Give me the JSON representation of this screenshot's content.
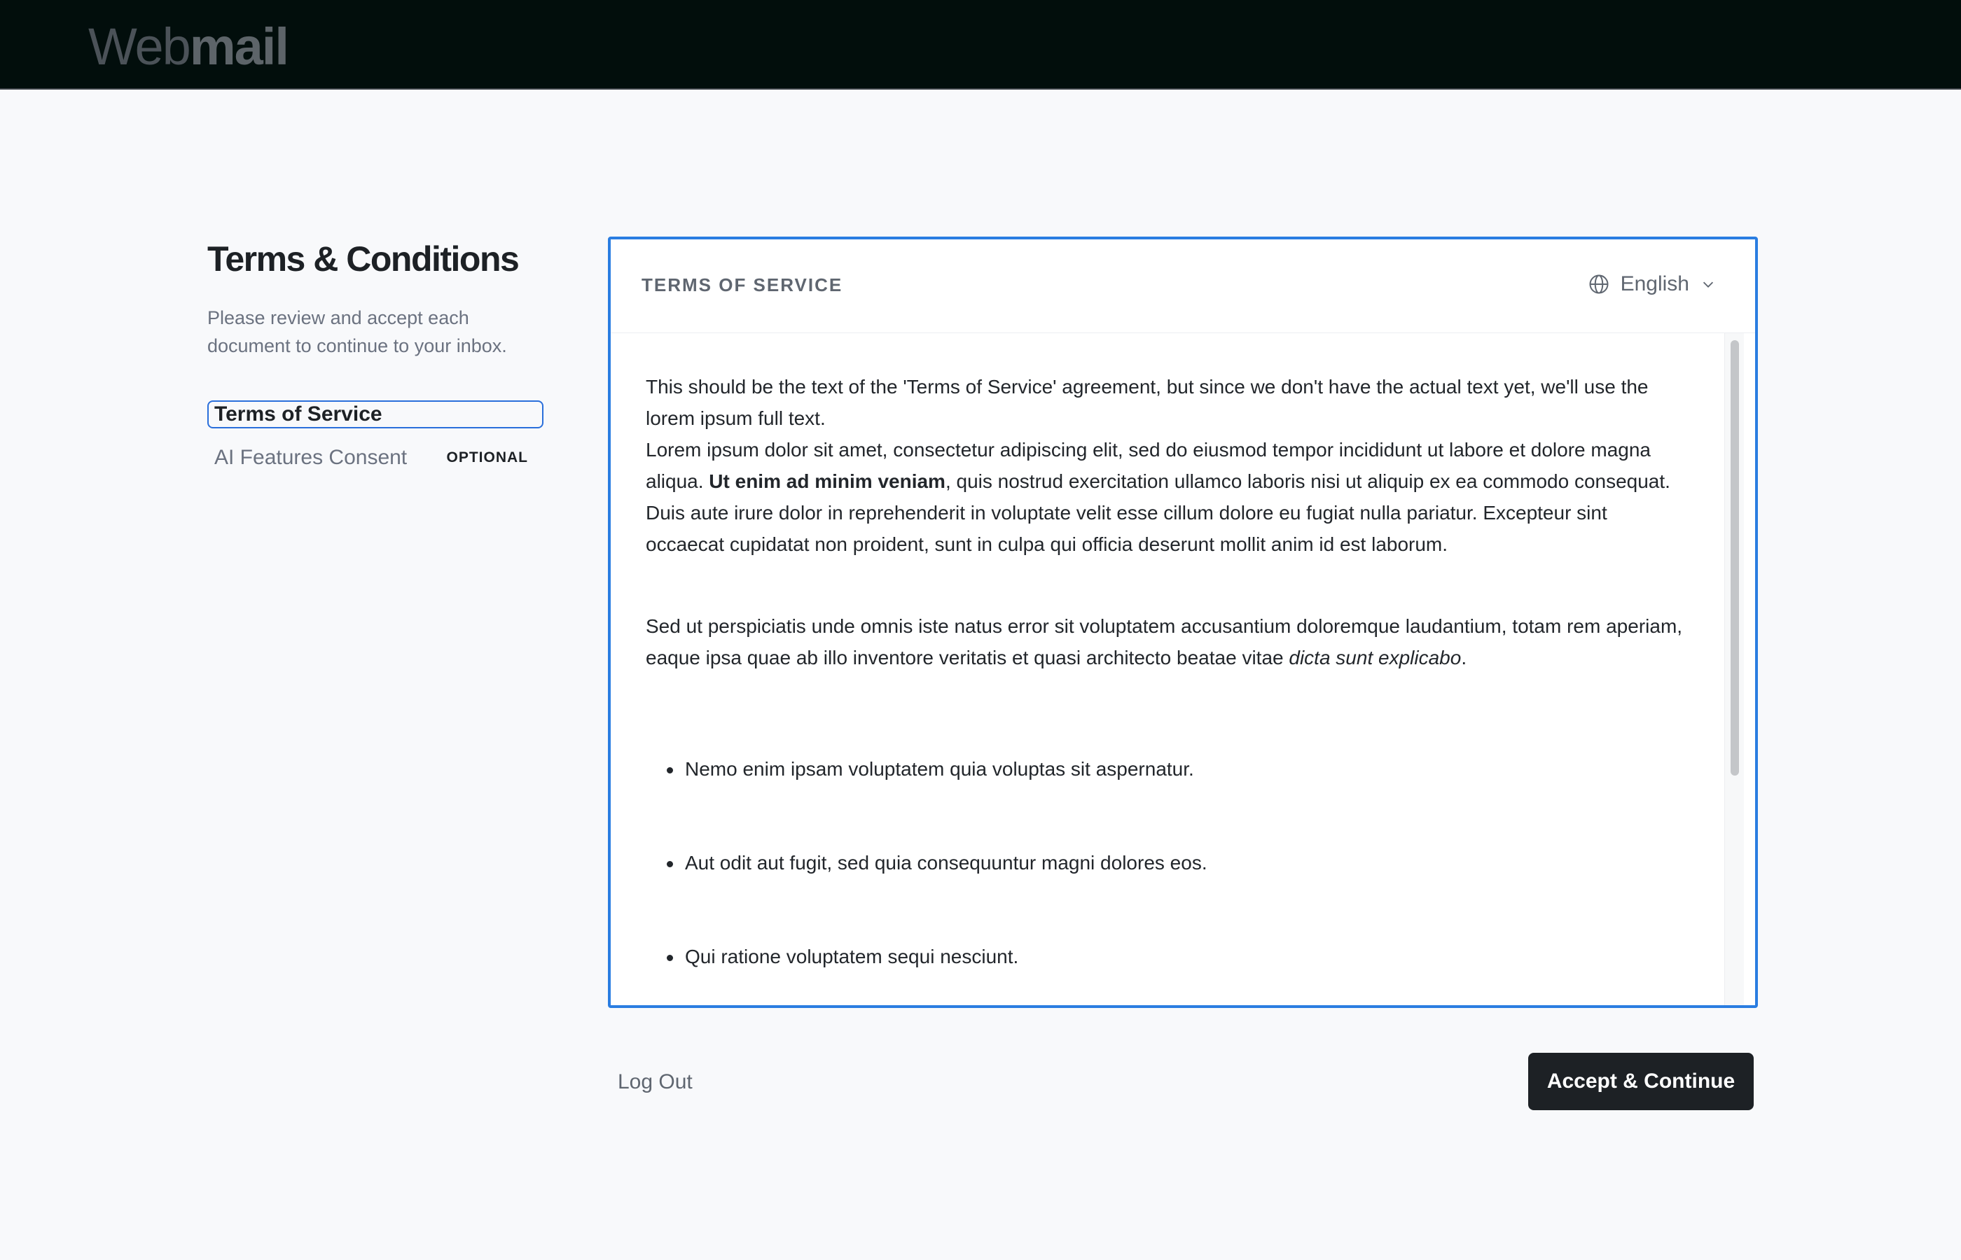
{
  "app": {
    "logo_light": "Web",
    "logo_bold": "mail"
  },
  "sidebar": {
    "title": "Terms & Conditions",
    "subtitle": "Please review and accept each document to continue to your inbox.",
    "items": [
      {
        "label": "Terms of Service",
        "badge": "",
        "active": true
      },
      {
        "label": "AI Features Consent",
        "badge": "OPTIONAL",
        "active": false
      }
    ]
  },
  "document": {
    "title": "TERMS OF SERVICE",
    "language": "English",
    "paragraph1": "This should be the text of the 'Terms of Service' agreement, but since we don't have the actual text yet, we'll use the lorem ipsum full text.",
    "paragraph2_start": "Lorem ipsum dolor sit amet, consectetur adipiscing elit, sed do eiusmod tempor incididunt ut labore et dolore magna aliqua. ",
    "paragraph2_bold": "Ut enim ad minim veniam",
    "paragraph2_end": ", quis nostrud exercitation ullamco laboris nisi ut aliquip ex ea commodo consequat. Duis aute irure dolor in reprehenderit in voluptate velit esse cillum dolore eu fugiat nulla pariatur. Excepteur sint occaecat cupidatat non proident, sunt in culpa qui officia deserunt mollit anim id est laborum.",
    "paragraph3_start": "Sed ut perspiciatis unde omnis iste natus error sit voluptatem accusantium doloremque laudantium, totam rem aperiam, eaque ipsa quae ab illo inventore veritatis et quasi architecto beatae vitae ",
    "paragraph3_italic": "dicta sunt explicabo",
    "paragraph3_end": ".",
    "bullets": [
      "Nemo enim ipsam voluptatem quia voluptas sit aspernatur.",
      "Aut odit aut fugit, sed quia consequuntur magni dolores eos.",
      "Qui ratione voluptatem sequi nesciunt."
    ]
  },
  "actions": {
    "logout_label": "Log Out",
    "accept_label": "Accept & Continue"
  },
  "colors": {
    "accent": "#2a7de1",
    "primary_button": "#1d2125",
    "topbar": "#020e0c"
  },
  "icons": {
    "language": "globe-icon",
    "dropdown": "chevron-down-icon"
  }
}
